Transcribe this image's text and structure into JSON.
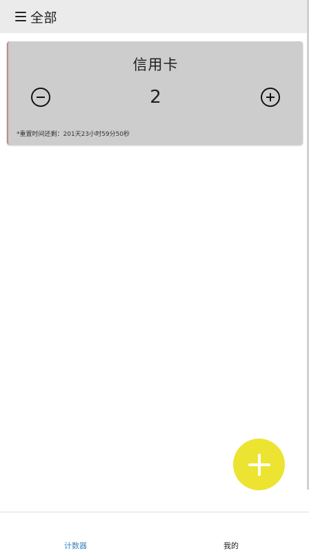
{
  "header": {
    "title": "全部",
    "menu_icon": "hamburger-menu-icon"
  },
  "counter_card": {
    "title": "信用卡",
    "count": "2",
    "reset_text": "*重置时间还剩：201天23小时59分50秒",
    "decrement_icon": "minus-circle-icon",
    "increment_icon": "plus-circle-icon"
  },
  "fab": {
    "icon": "plus-icon",
    "color": "#ede432"
  },
  "bottom_nav": {
    "items": [
      {
        "label": "计数器",
        "active": true,
        "color": "#3b82c4"
      },
      {
        "label": "我的",
        "active": false,
        "color": "#222222"
      }
    ]
  }
}
